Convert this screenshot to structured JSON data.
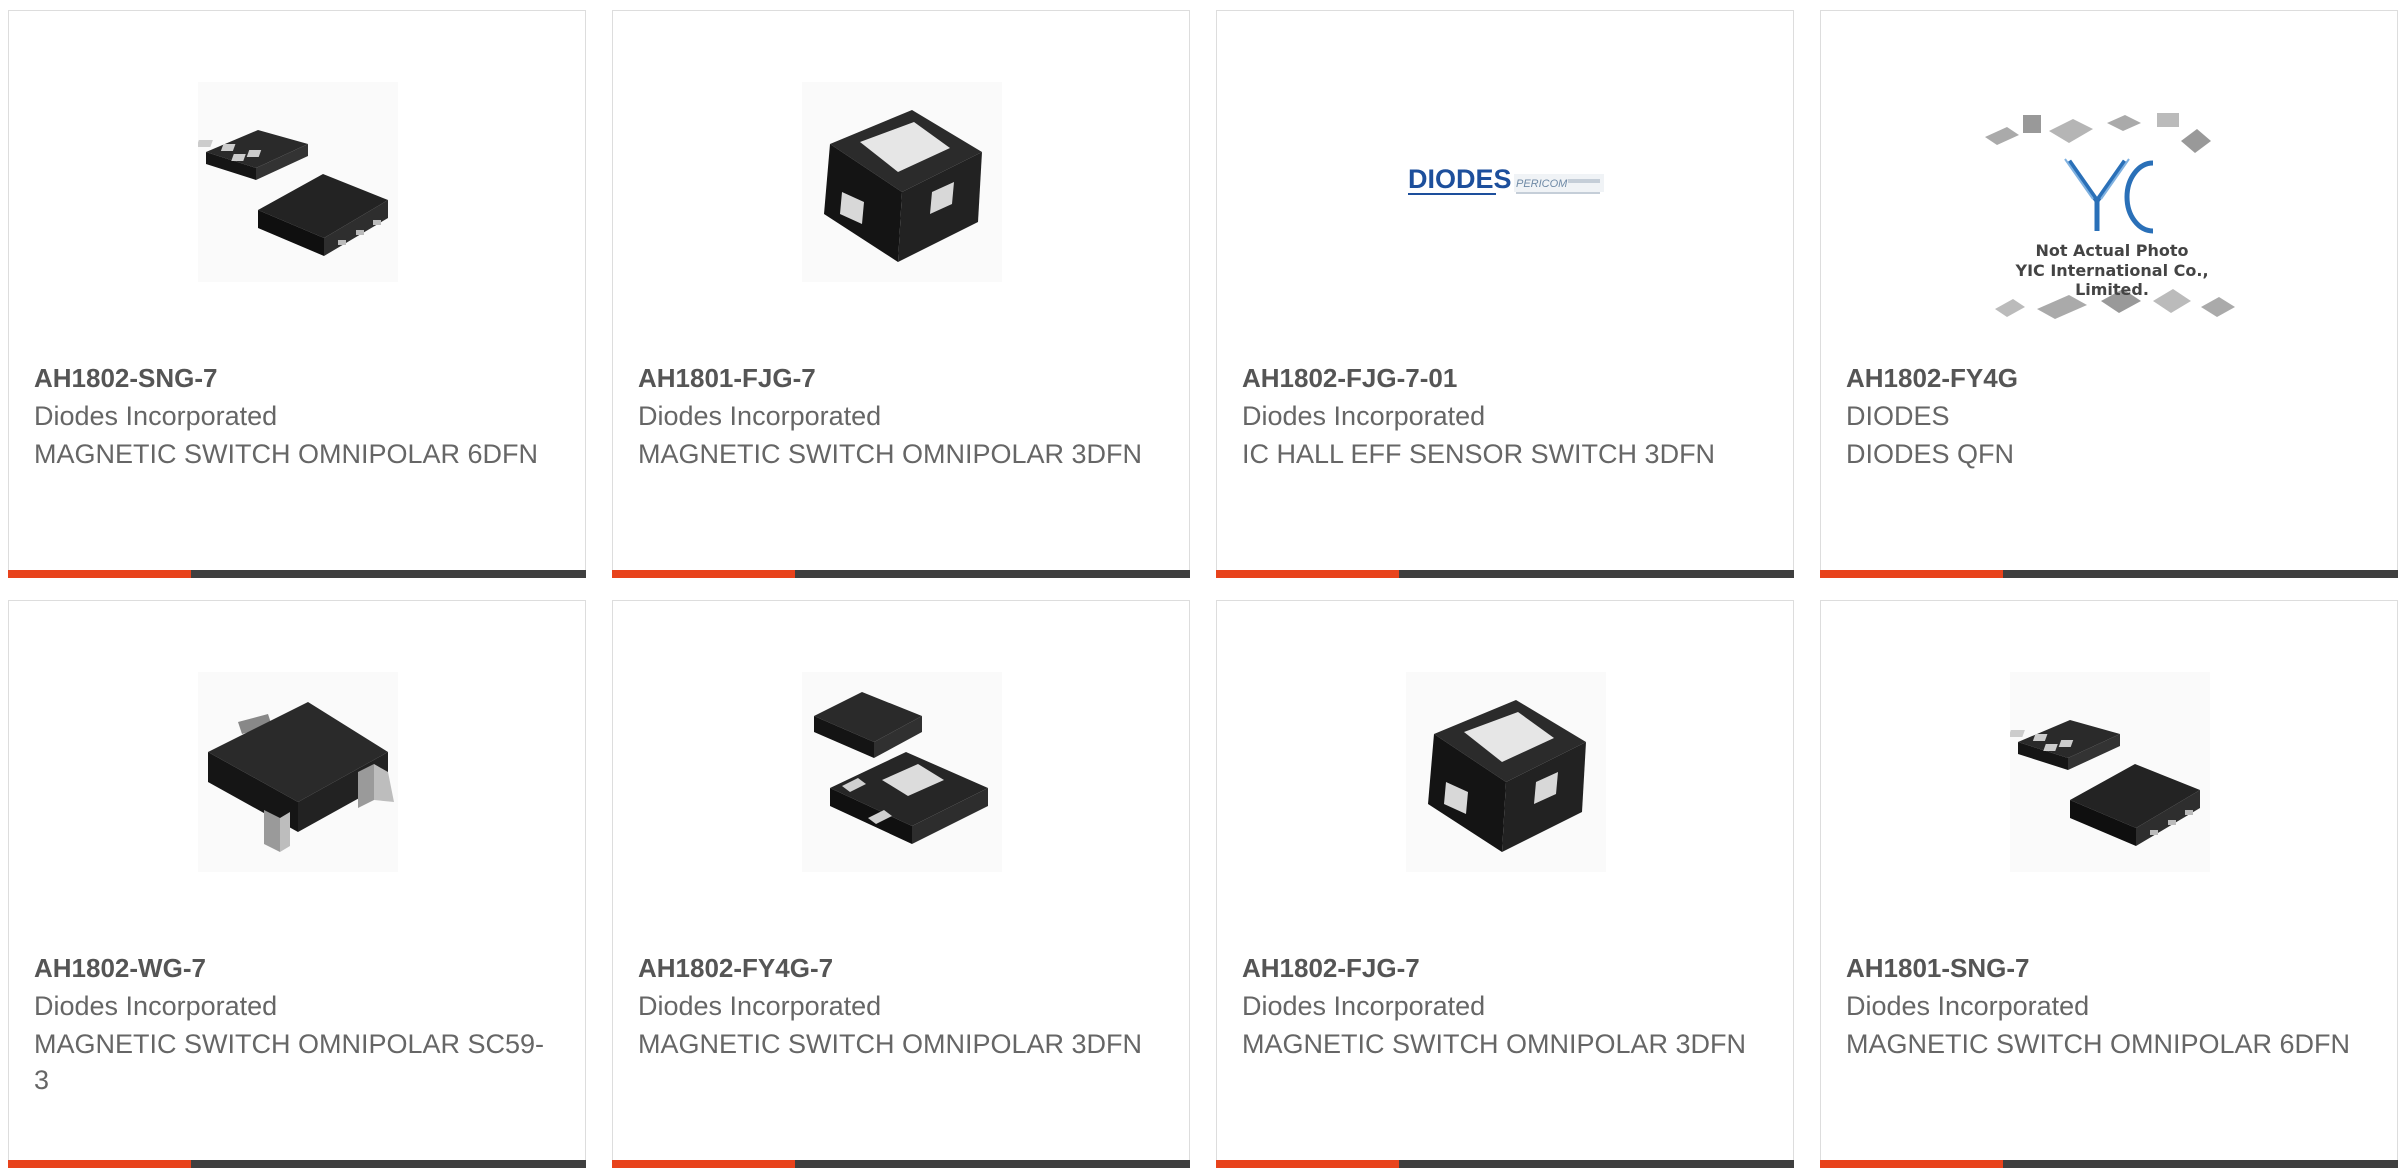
{
  "colors": {
    "accent": "#e8431c",
    "bar": "#3f3f3f",
    "text_bold": "#555555",
    "text": "#666666"
  },
  "products": [
    {
      "part": "AH1802-SNG-7",
      "manufacturer": "Diodes Incorporated",
      "description": "MAGNETIC SWITCH OMNIPOLAR 6DFN",
      "image": "dfn6-chip-icon"
    },
    {
      "part": "AH1801-FJG-7",
      "manufacturer": "Diodes Incorporated",
      "description": "MAGNETIC SWITCH OMNIPOLAR 3DFN",
      "image": "dfn3-chip-icon"
    },
    {
      "part": "AH1802-FJG-7-01",
      "manufacturer": "Diodes Incorporated",
      "description": "IC HALL EFF SENSOR SWITCH 3DFN",
      "image": "diodes-logo"
    },
    {
      "part": "AH1802-FY4G",
      "manufacturer": "DIODES",
      "description": "DIODES QFN",
      "image": "not-actual-photo",
      "placeholder_line1": "Not Actual Photo",
      "placeholder_line2": "YIC International Co., Limited."
    },
    {
      "part": "AH1802-WG-7",
      "manufacturer": "Diodes Incorporated",
      "description": "MAGNETIC SWITCH OMNIPOLAR SC59-3",
      "image": "sc59-chip-icon"
    },
    {
      "part": "AH1802-FY4G-7",
      "manufacturer": "Diodes Incorporated",
      "description": "MAGNETIC SWITCH OMNIPOLAR 3DFN",
      "image": "dfn3-pair-chip-icon"
    },
    {
      "part": "AH1802-FJG-7",
      "manufacturer": "Diodes Incorporated",
      "description": "MAGNETIC SWITCH OMNIPOLAR 3DFN",
      "image": "dfn3-chip-icon"
    },
    {
      "part": "AH1801-SNG-7",
      "manufacturer": "Diodes Incorporated",
      "description": "MAGNETIC SWITCH OMNIPOLAR 6DFN",
      "image": "dfn6-chip-icon"
    }
  ]
}
